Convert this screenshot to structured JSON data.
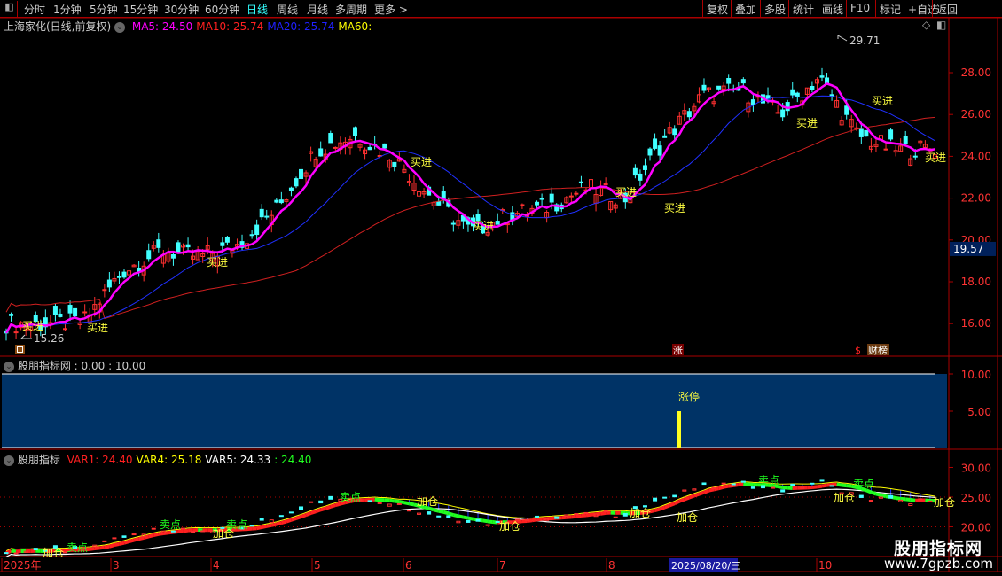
{
  "toolbar": {
    "tabs": [
      "分时",
      "1分钟",
      "5分钟",
      "15分钟",
      "30分钟",
      "60分钟",
      "日线",
      "周线",
      "月线",
      "多周期",
      "更多 >"
    ],
    "active_tab": "日线",
    "right_buttons": [
      "复权",
      "叠加",
      "多股",
      "统计",
      "画线",
      "F10",
      "标记",
      "+自选",
      "返回"
    ]
  },
  "main": {
    "title": "上海家化(日线,前复权)",
    "ma": [
      {
        "label": "MA5: 24.50",
        "color": "#ff00ff"
      },
      {
        "label": "MA10: 25.74",
        "color": "#ff2020"
      },
      {
        "label": "MA20: 25.74",
        "color": "#2020ff"
      },
      {
        "label": "MA60:",
        "color": "#ffff00"
      }
    ],
    "y_ticks": [
      "28.00",
      "26.00",
      "24.00",
      "22.00",
      "20.00",
      "18.00",
      "16.00"
    ],
    "current_price": "19.57",
    "high_label": "29.71",
    "low_label": "15.26",
    "buy_label": "买进",
    "event_tags": [
      "涨",
      "财榜"
    ],
    "closes": [
      16.0,
      16.0,
      16.1,
      18.5,
      19.5,
      19.2,
      19.8,
      21.5,
      24.3,
      25.0,
      24.0,
      22.0,
      20.4,
      21.2,
      21.6,
      22.5,
      22.0,
      24.8,
      26.9,
      27.2,
      26.0,
      27.8,
      25.0,
      24.3,
      24.4
    ]
  },
  "pane1": {
    "title": "股朋指标网",
    "values": ": 0.00 : 10.00",
    "y_ticks": [
      "10.00",
      "5.00"
    ],
    "limit_up_label": "涨停"
  },
  "pane2": {
    "title": "股朋指标",
    "vars": [
      {
        "label": "VAR1: 24.40",
        "color": "#ff2020"
      },
      {
        "label": "VAR4: 25.18",
        "color": "#ffff00"
      },
      {
        "label": "VAR5: 24.33",
        "color": "#ffffff"
      },
      {
        "label": ": 24.40",
        "color": "#20ff20"
      }
    ],
    "y_ticks": [
      "30.00",
      "25.00",
      "20.00"
    ],
    "add_label": "加仓",
    "sell_label": "卖点"
  },
  "date_axis": {
    "labels": [
      "2025年",
      "3",
      "4",
      "5",
      "6",
      "7",
      "8",
      "10"
    ],
    "cursor_date": "2025/08/20/三"
  },
  "watermark": {
    "name": "股朋指标网",
    "url": "www.7gpzb.com"
  }
}
